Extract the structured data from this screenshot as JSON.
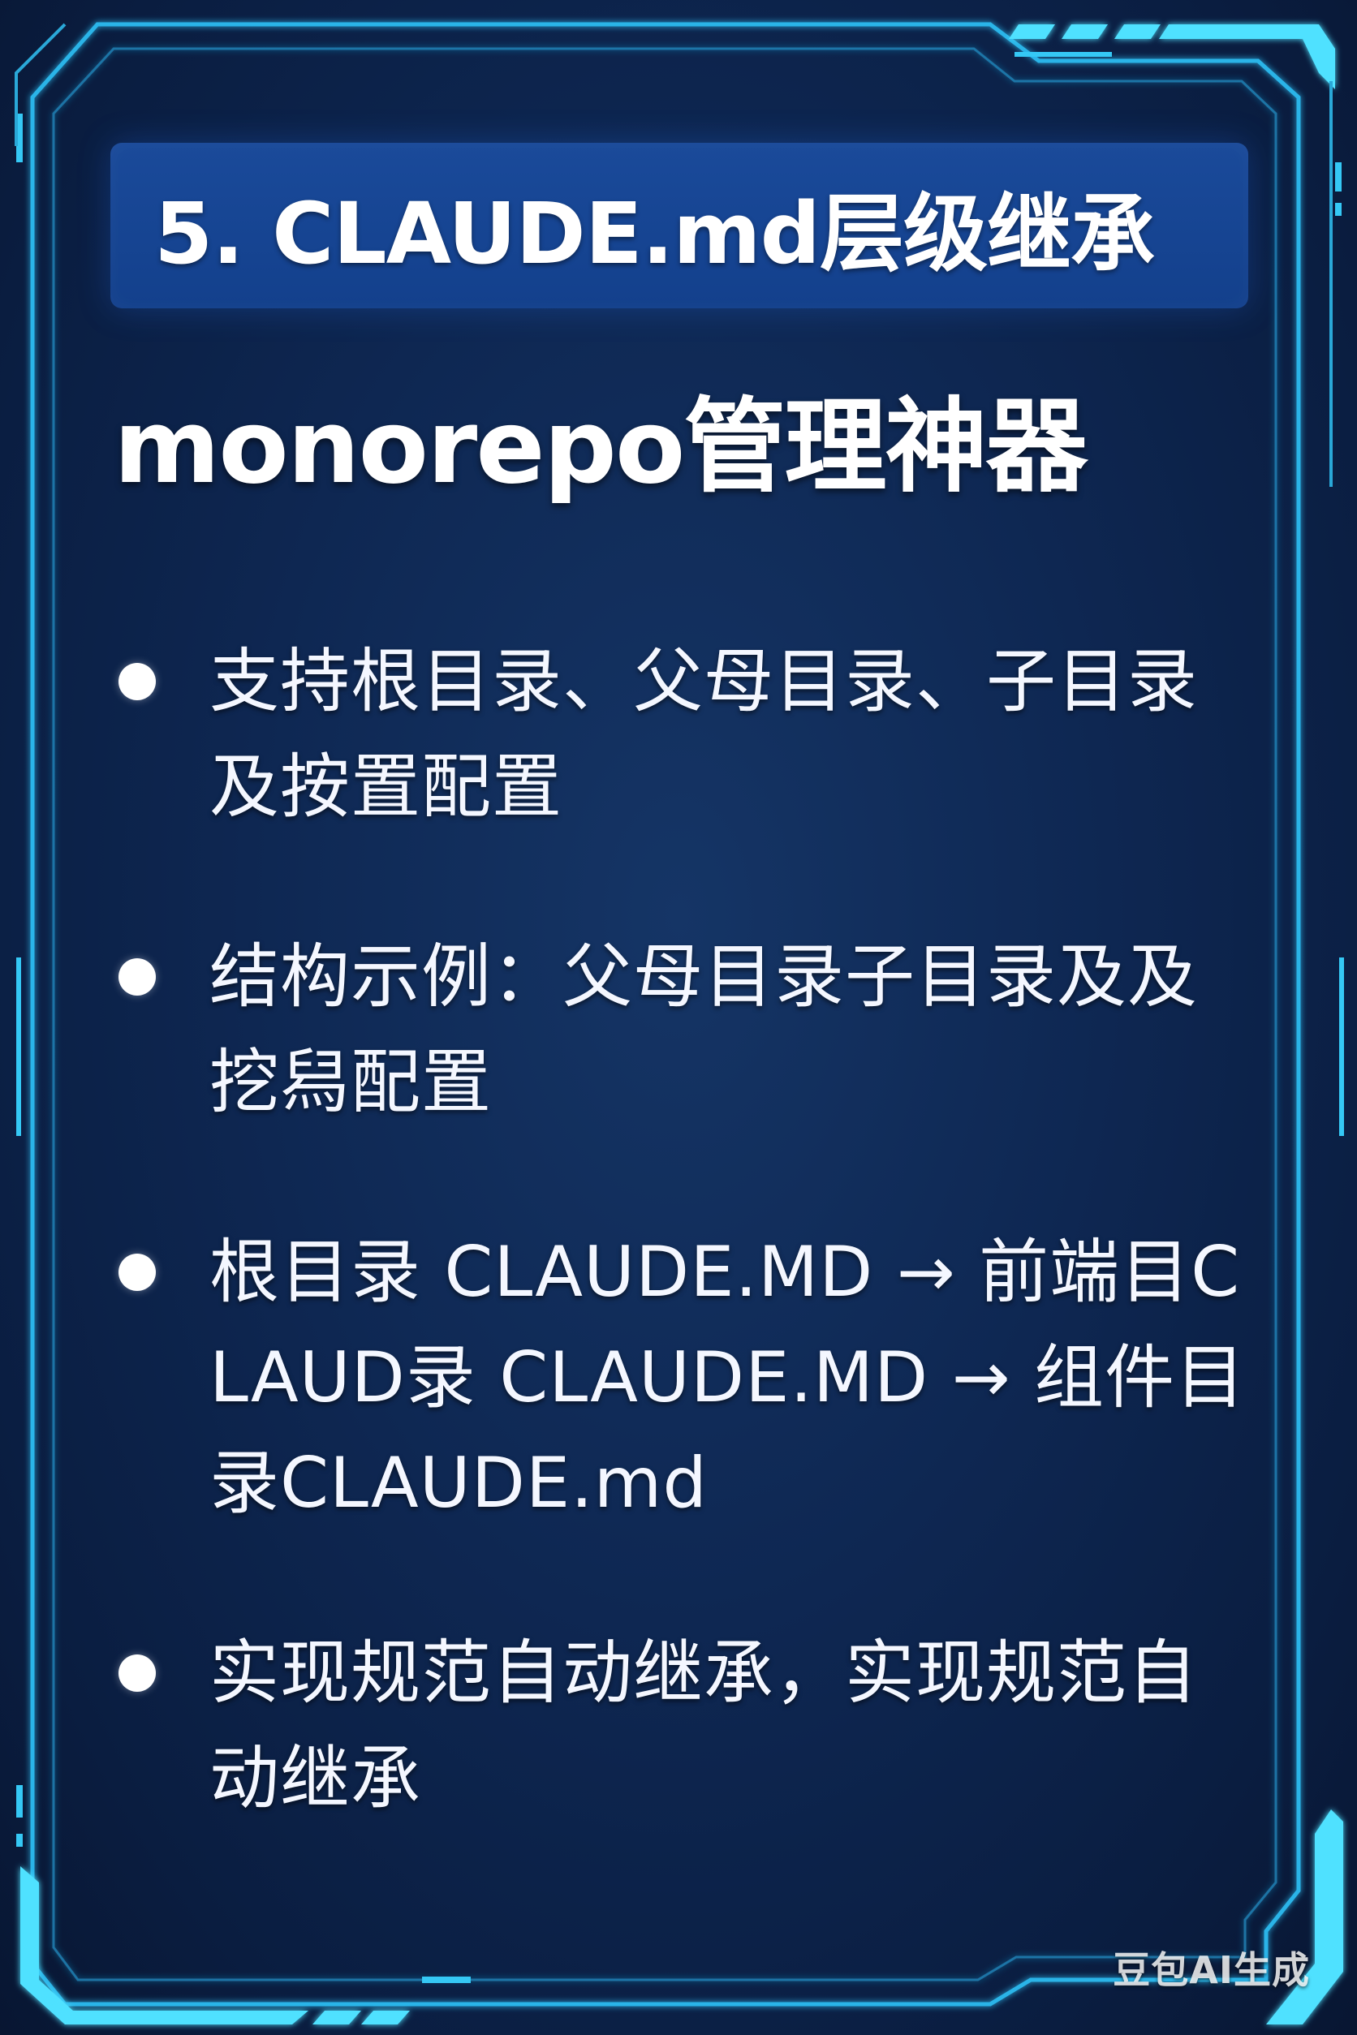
{
  "title": "5. CLAUDE.md层级继承",
  "subtitle": "monorepo管理神器",
  "bullets": [
    {
      "text": "支持根目录、父母目录、子目录及按置配置"
    },
    {
      "text": "结构示例：父母目录子目录及及挖舄配置"
    },
    {
      "text": "根目录 CLAUDE.MD → 前端目CLAUD录 CLAUDE.MD → 组件目录CLAUDE.md"
    },
    {
      "text": "实现规范自动继承，实现规范自动继承"
    }
  ],
  "watermark": "豆包AI生成",
  "colors": {
    "background": "#0e2752",
    "banner": "#13408c",
    "frame_accent": "#3fd4ff",
    "text": "#ffffff"
  }
}
